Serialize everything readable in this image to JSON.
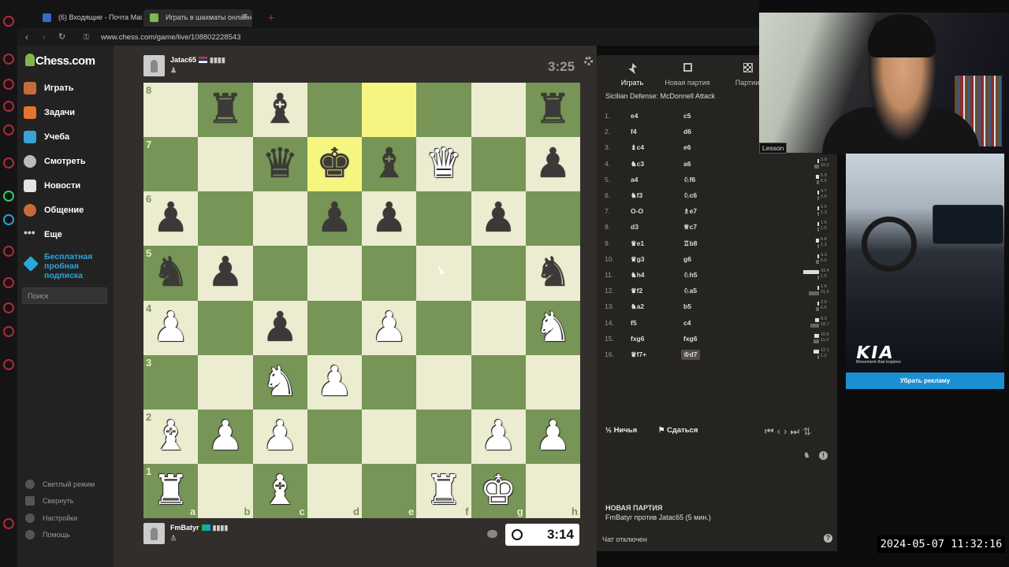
{
  "browser": {
    "tabs": [
      {
        "label": "(6) Входящие - Почта Mai",
        "color": "#3b68c9"
      },
      {
        "label": "Играть в шахматы онлайн",
        "color": "#81b64c"
      }
    ],
    "url": "www.chess.com/game/live/108802228543"
  },
  "nav": {
    "logo": "Chess.com",
    "items": [
      {
        "label": "Играть",
        "icon": "play-icon",
        "color": "#c96a3a"
      },
      {
        "label": "Задачи",
        "icon": "puzzle-icon",
        "color": "#e4742d"
      },
      {
        "label": "Учеба",
        "icon": "learn-icon",
        "color": "#3aa4d6"
      },
      {
        "label": "Смотреть",
        "icon": "watch-icon",
        "color": "#bbb"
      },
      {
        "label": "Новости",
        "icon": "news-icon",
        "color": "#e4e4e4"
      },
      {
        "label": "Общение",
        "icon": "social-icon",
        "color": "#c96a3a"
      },
      {
        "label": "Еще",
        "icon": "more-icon",
        "color": "#ccc"
      }
    ],
    "trial": "Бесплатная пробная подписка",
    "search_placeholder": "Поиск",
    "bottom": [
      "Светлый режим",
      "Свернуть",
      "Настройки",
      "Помощь"
    ]
  },
  "game": {
    "top_player": {
      "name": "Jatac65",
      "clock": "3:25"
    },
    "bottom_player": {
      "name": "FmBatyr",
      "clock": "3:14"
    },
    "board": {
      "8": [
        "",
        "r",
        "b",
        "",
        "",
        "",
        "",
        "r"
      ],
      "7": [
        "",
        "",
        "q",
        "k",
        "b",
        "Q",
        "",
        "p"
      ],
      "6": [
        "p",
        "",
        "",
        "p",
        "p",
        "",
        "p",
        ""
      ],
      "5": [
        "n",
        "p",
        "",
        "",
        "",
        "",
        "",
        "n"
      ],
      "4": [
        "P",
        "",
        "p",
        "",
        "P",
        "",
        "",
        "N"
      ],
      "3": [
        "",
        "",
        "N",
        "P",
        "",
        "",
        "",
        ""
      ],
      "2": [
        "B",
        "P",
        "P",
        "",
        "",
        "",
        "P",
        "P"
      ],
      "1": [
        "R",
        "",
        "B",
        "",
        "",
        "R",
        "K",
        ""
      ]
    },
    "highlight": [
      "d7",
      "e8"
    ],
    "files": [
      "a",
      "b",
      "c",
      "d",
      "e",
      "f",
      "g",
      "h"
    ],
    "ranks": [
      "8",
      "7",
      "6",
      "5",
      "4",
      "3",
      "2",
      "1"
    ]
  },
  "panel": {
    "tabs": [
      "Играть",
      "Новая партия",
      "Партии"
    ],
    "opening": "Sicilian Defense: McDonnell Attack",
    "moves": [
      {
        "n": "1.",
        "w": "e4",
        "b": "c5",
        "wt": "",
        "bt": ""
      },
      {
        "n": "2.",
        "w": "f4",
        "b": "d6",
        "wt": "",
        "bt": ""
      },
      {
        "n": "3.",
        "w": "♝c4",
        "b": "e6",
        "wt": "1.9",
        "bt": "3.9"
      },
      {
        "n": "4.",
        "w": "♞c3",
        "b": "a6",
        "wt": "3.9",
        "bt": "10.2"
      },
      {
        "n": "5.",
        "w": "a4",
        "b": "♘f6",
        "wt": "5.9",
        "bt": "5.5"
      },
      {
        "n": "6.",
        "w": "♞f3",
        "b": "♘c6",
        "wt": "3.7",
        "bt": "2.5"
      },
      {
        "n": "7.",
        "w": "O-O",
        "b": "♗e7",
        "wt": "2.0",
        "bt": "1.3"
      },
      {
        "n": "8.",
        "w": "d3",
        "b": "♕c7",
        "wt": "1.6",
        "bt": "1.5"
      },
      {
        "n": "9.",
        "w": "♛e1",
        "b": "♖b8",
        "wt": "6.8",
        "bt": "1.3"
      },
      {
        "n": "10.",
        "w": "♛g3",
        "b": "g6",
        "wt": "3.3",
        "bt": "6.5"
      },
      {
        "n": "11.",
        "w": "♞h4",
        "b": "♘h5",
        "wt": "33.4",
        "bt": "1.5"
      },
      {
        "n": "12.",
        "w": "♛f2",
        "b": "♘a5",
        "wt": "1.6",
        "bt": "21.6"
      },
      {
        "n": "13.",
        "w": "♞a2",
        "b": "b5",
        "wt": "2.9",
        "bt": "6.6"
      },
      {
        "n": "14.",
        "w": "f5",
        "b": "c4",
        "wt": "8.3",
        "bt": "18.7"
      },
      {
        "n": "15.",
        "w": "fxg6",
        "b": "fxg6",
        "wt": "10.6",
        "bt": "11.0"
      },
      {
        "n": "16.",
        "w": "♛f7+",
        "b": "♔d7",
        "wt": "12.1",
        "bt": "1.2"
      }
    ],
    "draw": "Ничья",
    "resign": "Сдаться",
    "new_game_title": "НОВАЯ ПАРТИЯ",
    "new_game_sub": "FmBatyr против Jatac65 (5 мин.)",
    "chat_off": "Чат отключен"
  },
  "overlay": {
    "cam_label": "Lesson",
    "ad_brand": "KIA",
    "ad_tagline": "Movement that inspires",
    "ad_button": "Убрать рекламу",
    "timestamp": "2024-05-07  11:32:16"
  }
}
